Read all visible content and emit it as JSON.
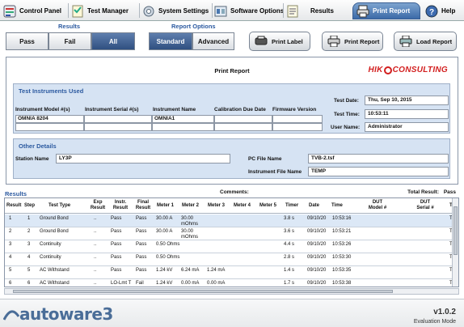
{
  "tabs": [
    {
      "label": "Control Panel",
      "icon": "control-panel-icon"
    },
    {
      "label": "Test Manager",
      "icon": "test-manager-icon"
    },
    {
      "label": "System Settings",
      "icon": "system-settings-icon"
    },
    {
      "label": "Software Options",
      "icon": "software-options-icon"
    },
    {
      "label": "Results",
      "icon": "results-icon"
    },
    {
      "label": "Print Report",
      "icon": "print-report-icon",
      "active": true
    },
    {
      "label": "Help",
      "icon": "help-icon"
    }
  ],
  "results_filter": {
    "label": "Results",
    "pass": "Pass",
    "fail": "Fail",
    "all": "All",
    "selected": "All"
  },
  "report_options": {
    "label": "Report Options",
    "standard": "Standard",
    "advanced": "Advanced",
    "selected": "Standard"
  },
  "actions": {
    "print_label": "Print Label",
    "print_report": "Print Report",
    "load_report": "Load Report"
  },
  "report": {
    "title": "Print Report",
    "logo": {
      "left": "HIK",
      "right": "CONSULTING"
    },
    "test_instruments": {
      "title": "Test Instruments Used",
      "headers": {
        "model": "Instrument Model #(s)",
        "serial": "Instrument Serial #(s)",
        "name": "Instrument Name",
        "calibration": "Calibration Due Date",
        "firmware": "Firmware Version"
      },
      "rows": [
        {
          "model": "OMNIA 8204",
          "serial": "",
          "name": "OMNIA1",
          "calibration": "",
          "firmware": ""
        }
      ]
    },
    "test_date": {
      "label": "Test Date:",
      "value": "Thu, Sep 10, 2015"
    },
    "test_time": {
      "label": "Test Time:",
      "value": "10:53:11"
    },
    "user_name": {
      "label": "User Name:",
      "value": "Administrator"
    },
    "other_details": {
      "title": "Other Details",
      "station_name": {
        "label": "Station Name",
        "value": "LY3P"
      },
      "pc_file_name": {
        "label": "PC File Name",
        "value": "TVB-2.tsf"
      },
      "instrument_file_name": {
        "label": "Instrument File Name",
        "value": "TEMP"
      }
    }
  },
  "results": {
    "label": "Results",
    "comments_label": "Comments:",
    "total_result_label": "Total Result:",
    "total_result_value": "Pass",
    "columns": [
      "Result",
      "Step",
      "Test Type",
      "Exp Result",
      "Instr. Result",
      "Final Result",
      "Meter 1",
      "Meter 2",
      "Meter 3",
      "Meter 4",
      "Meter 5",
      "Timer",
      "Date",
      "Time",
      "DUT Model #",
      "DUT Serial #",
      "T"
    ],
    "rows": [
      {
        "result": "1",
        "step": "1",
        "type": "Ground Bond",
        "exp": "..",
        "instr": "Pass",
        "final": "Pass",
        "m1": "30.00 A",
        "m2": "30.00 mOhms",
        "m3": "",
        "m4": "",
        "m5": "",
        "timer": "3.8 s",
        "date": "09/10/20",
        "time": "10:53:16",
        "model": "",
        "serial": "",
        "t": "T"
      },
      {
        "result": "2",
        "step": "2",
        "type": "Ground Bond",
        "exp": "..",
        "instr": "Pass",
        "final": "Pass",
        "m1": "30.00 A",
        "m2": "30.00 mOhms",
        "m3": "",
        "m4": "",
        "m5": "",
        "timer": "3.6 s",
        "date": "09/10/20",
        "time": "10:53:21",
        "model": "",
        "serial": "",
        "t": "T"
      },
      {
        "result": "3",
        "step": "3",
        "type": "Continuity",
        "exp": "..",
        "instr": "Pass",
        "final": "Pass",
        "m1": "0.50 Ohms",
        "m2": "",
        "m3": "",
        "m4": "",
        "m5": "",
        "timer": "4.4 s",
        "date": "09/10/20",
        "time": "10:53:26",
        "model": "",
        "serial": "",
        "t": "T"
      },
      {
        "result": "4",
        "step": "4",
        "type": "Continuity",
        "exp": "..",
        "instr": "Pass",
        "final": "Pass",
        "m1": "0.50 Ohms",
        "m2": "",
        "m3": "",
        "m4": "",
        "m5": "",
        "timer": "2.8 s",
        "date": "09/10/20",
        "time": "10:53:30",
        "model": "",
        "serial": "",
        "t": "T"
      },
      {
        "result": "5",
        "step": "5",
        "type": "AC Withstand",
        "exp": "..",
        "instr": "Pass",
        "final": "Pass",
        "m1": "1.24 kV",
        "m2": "6.24 mA",
        "m3": "1.24 mA",
        "m4": "",
        "m5": "",
        "timer": "1.4 s",
        "date": "09/10/20",
        "time": "10:53:35",
        "model": "",
        "serial": "",
        "t": "T"
      },
      {
        "result": "6",
        "step": "6",
        "type": "AC Withstand",
        "exp": "..",
        "instr": "LO-Lmt T",
        "final": "Fail",
        "m1": "1.24 kV",
        "m2": "0.00 mA",
        "m3": "0.00 mA",
        "m4": "",
        "m5": "",
        "timer": "1.7 s",
        "date": "09/10/20",
        "time": "10:53:38",
        "model": "",
        "serial": "",
        "t": "T"
      }
    ]
  },
  "footer": {
    "brand": "autoware3",
    "version": "v1.0.2",
    "mode": "Evaluation Mode"
  },
  "colors": {
    "accent": "#2c5aa0",
    "logo_red": "#d21e1e",
    "section_bg": "#d6e3f3",
    "active_tab": "#3c6aa8"
  }
}
